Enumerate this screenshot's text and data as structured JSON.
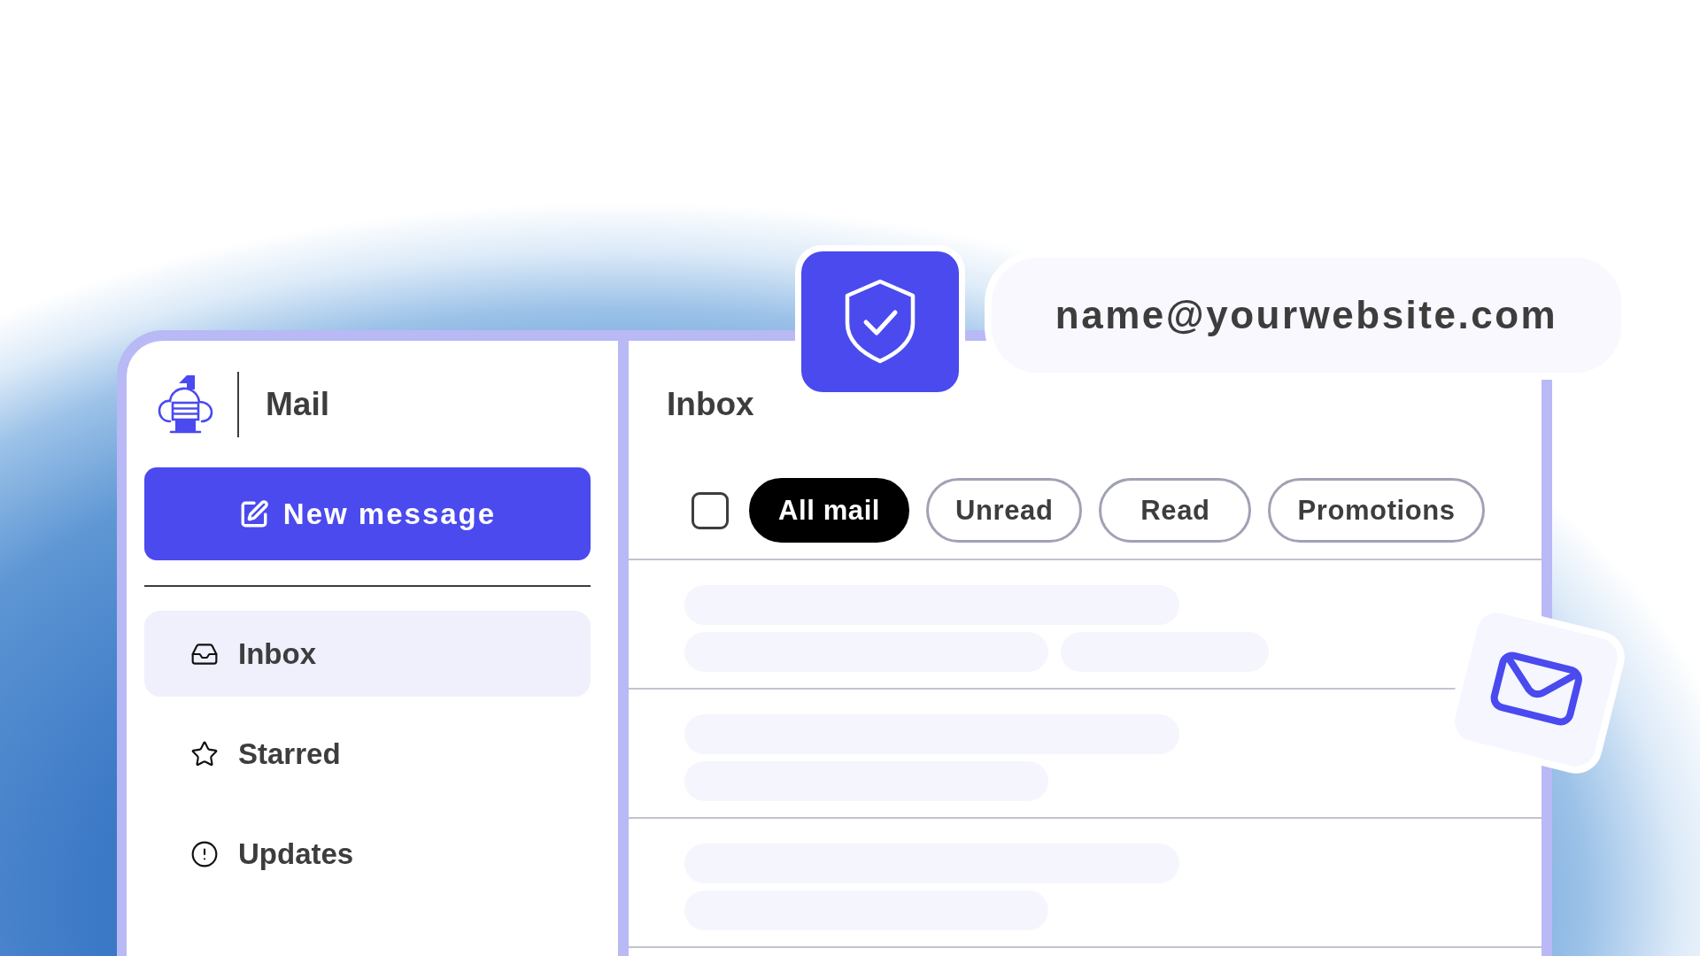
{
  "app": {
    "title": "Mail"
  },
  "sidebar": {
    "new_message": "New message",
    "items": [
      {
        "label": "Inbox",
        "kind": "inbox",
        "selected": true
      },
      {
        "label": "Starred",
        "kind": "star",
        "selected": false
      },
      {
        "label": "Updates",
        "kind": "alert",
        "selected": false
      }
    ]
  },
  "main": {
    "title": "Inbox",
    "select_all": {
      "checked": false
    },
    "filters": [
      {
        "label": "All mail",
        "selected": true
      },
      {
        "label": "Unread",
        "selected": false
      },
      {
        "label": "Read",
        "selected": false
      },
      {
        "label": "Promotions",
        "selected": false
      }
    ]
  },
  "email_field": {
    "value": "name@yourwebsite.com"
  }
}
